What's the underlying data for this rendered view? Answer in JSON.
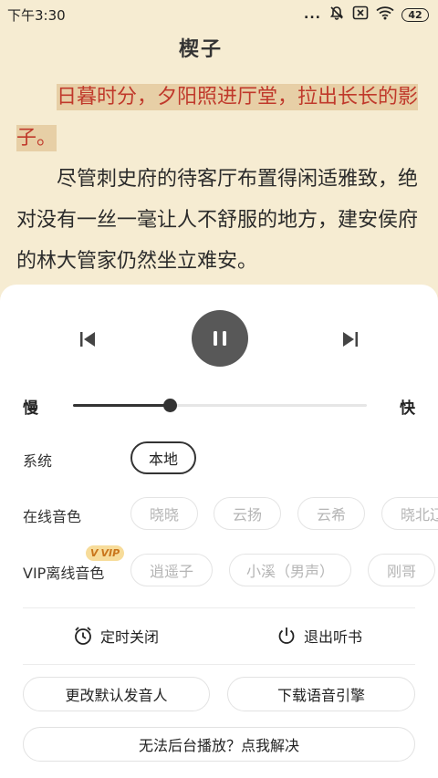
{
  "status_bar": {
    "time": "下午3:30",
    "signal_dots": "...",
    "battery": "42"
  },
  "reader": {
    "title": "楔子",
    "highlighted": "日暮时分，夕阳照进厅堂，拉出长长的影子。",
    "paragraph2": "尽管刺史府的待客厅布置得闲适雅致，绝对没有一丝一毫让人不舒服的地方，建安侯府的林大管家仍然坐立难安。",
    "highlight_color": "#c0392b"
  },
  "player": {
    "prev_icon": "skip-previous-icon",
    "pause_icon": "pause-icon",
    "next_icon": "skip-next-icon"
  },
  "speed": {
    "slow_label": "慢",
    "fast_label": "快",
    "level": 0.33
  },
  "system_row": {
    "label": "系统",
    "options": [
      "本地"
    ]
  },
  "online_row": {
    "label": "在线音色",
    "options": [
      "晓晓",
      "云扬",
      "云希",
      "晓北辽"
    ]
  },
  "vip_row": {
    "label": "VIP离线音色",
    "badge": "VIP",
    "badge_mark": "V",
    "options": [
      "逍遥子",
      "小溪（男声）",
      "刚哥"
    ]
  },
  "actions": {
    "timer_label": "定时关闭",
    "exit_label": "退出听书",
    "change_voice_label": "更改默认发音人",
    "download_engine_label": "下载语音引擎",
    "background_fix_label": "无法后台播放？点我解决"
  }
}
